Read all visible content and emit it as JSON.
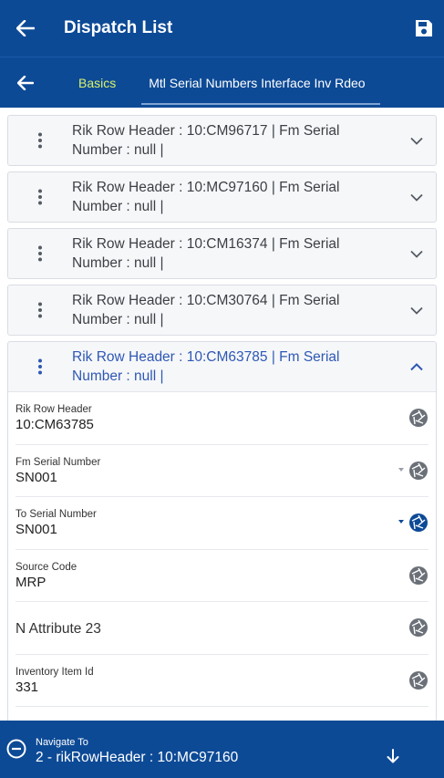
{
  "appbar": {
    "title": "Dispatch List"
  },
  "tabs": [
    {
      "label": "Basics"
    },
    {
      "label": "Mtl Serial Numbers Interface Inv Rdeo"
    }
  ],
  "records": [
    {
      "line1": "Rik Row Header  : 10:CM96717 | Fm Serial",
      "line2": "Number  : null |"
    },
    {
      "line1": "Rik Row Header  : 10:MC97160 | Fm Serial",
      "line2": "Number  : null |"
    },
    {
      "line1": "Rik Row Header  : 10:CM16374 | Fm Serial",
      "line2": "Number  : null |"
    },
    {
      "line1": "Rik Row Header  : 10:CM30764 | Fm Serial",
      "line2": "Number  : null |"
    },
    {
      "line1": "Rik Row Header  : 10:CM63785 | Fm Serial",
      "line2": "Number  : null |"
    }
  ],
  "detail": {
    "rik_row_header": {
      "label": "Rik Row Header",
      "value": "10:CM63785"
    },
    "fm_serial_number": {
      "label": "Fm Serial Number",
      "value": "SN001"
    },
    "to_serial_number": {
      "label": "To Serial Number",
      "value": "SN001"
    },
    "source_code": {
      "label": "Source Code",
      "value": "MRP"
    },
    "n_attribute_23": {
      "label": "N Attribute 23"
    },
    "inventory_item_id": {
      "label": "Inventory Item Id",
      "value": "331"
    }
  },
  "navigate": {
    "label": "Navigate To",
    "value": "2 - rikRowHeader : 10:MC97160"
  },
  "colors": {
    "primary": "#0d4a96",
    "tab_active_text": "#d7f26a",
    "expanded_text": "#2e58b4"
  }
}
